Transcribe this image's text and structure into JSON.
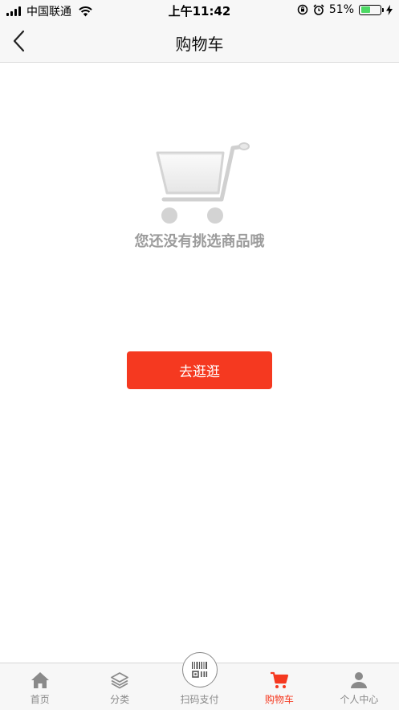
{
  "status_bar": {
    "carrier": "中国联通",
    "time": "上午11:42",
    "battery": "51%",
    "battery_level": 0.51,
    "battery_color": "#4cd964"
  },
  "nav": {
    "title": "购物车",
    "back_icon": "chevron-left-icon"
  },
  "empty_state": {
    "icon": "shopping-cart-icon",
    "message": "您还没有挑选商品哦",
    "button_label": "去逛逛",
    "button_color": "#f53920"
  },
  "tabs": [
    {
      "label": "首页",
      "icon": "home-icon",
      "active": false
    },
    {
      "label": "分类",
      "icon": "layers-icon",
      "active": false
    },
    {
      "label": "扫码支付",
      "icon": "barcode-scan-icon",
      "active": false
    },
    {
      "label": "购物车",
      "icon": "cart-icon",
      "active": true
    },
    {
      "label": "个人中心",
      "icon": "user-icon",
      "active": false
    }
  ],
  "colors": {
    "accent": "#f53920",
    "inactive": "#8a8a8a"
  }
}
